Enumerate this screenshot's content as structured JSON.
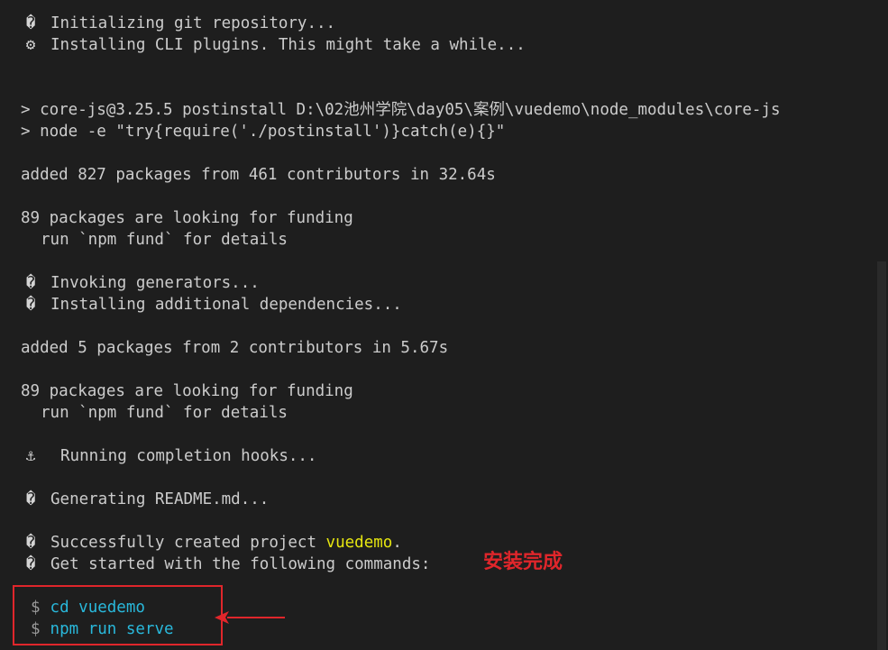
{
  "terminal": {
    "lines": {
      "init_git": {
        "icon": "�",
        "text": "Initializing git repository..."
      },
      "install_plugins": {
        "icon": "⚙",
        "text": "Installing CLI plugins. This might take a while..."
      },
      "postinstall_1": "> core-js@3.25.5 postinstall D:\\02池州学院\\day05\\案例\\vuedemo\\node_modules\\core-js",
      "postinstall_2": "> node -e \"try{require('./postinstall')}catch(e){}\"",
      "added_1": "added 827 packages from 461 contributors in 32.64s",
      "funding_1a": "89 packages are looking for funding",
      "funding_1b": "run `npm fund` for details",
      "invoke_gen": {
        "icon": "�",
        "text": "Invoking generators..."
      },
      "install_deps": {
        "icon": "�",
        "text": "Installing additional dependencies..."
      },
      "added_2": "added 5 packages from 2 contributors in 5.67s",
      "funding_2a": "89 packages are looking for funding",
      "funding_2b": "run `npm fund` for details",
      "completion_hooks": {
        "icon": "⚓",
        "text": "Running completion hooks..."
      },
      "gen_readme": {
        "icon": "�",
        "text": "Generating README.md..."
      },
      "success": {
        "icon": "�",
        "text": "Successfully created project ",
        "project": "vuedemo",
        "suffix": "."
      },
      "get_started": {
        "icon": "�",
        "text": "Get started with the following commands:"
      }
    },
    "commands": [
      {
        "prompt": "$",
        "cmd": "cd vuedemo"
      },
      {
        "prompt": "$",
        "cmd": "npm run serve"
      }
    ]
  },
  "annotation": {
    "text": "安装完成",
    "color": "#e0262b"
  },
  "colors": {
    "background": "#1e1e1e",
    "foreground": "#cccccc",
    "highlight_yellow": "#e5e510",
    "command_cyan": "#29b8db",
    "annotation_red": "#e0262b"
  }
}
